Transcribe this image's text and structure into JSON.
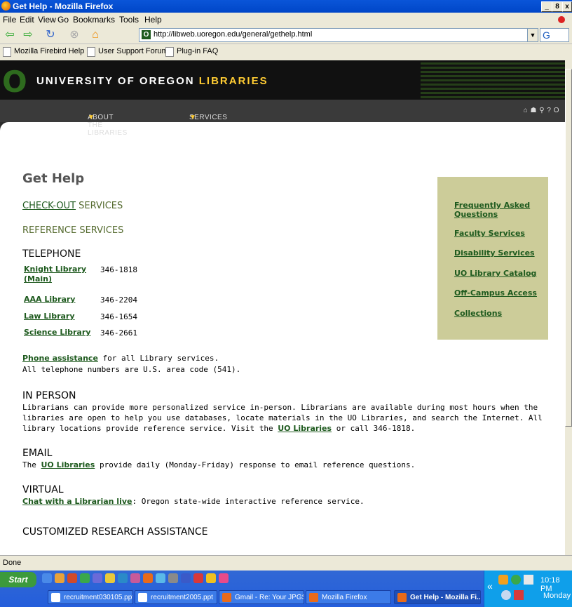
{
  "window": {
    "title": "Get Help - Mozilla Firefox",
    "min": "_",
    "max": "8",
    "close": "x"
  },
  "menu": [
    "File",
    "Edit",
    "View",
    "Go",
    "Bookmarks",
    "Tools",
    "Help"
  ],
  "address": {
    "url": "http://libweb.uoregon.edu/general/gethelp.html"
  },
  "bookmarks": [
    "Mozilla Firebird Help",
    "User Support Forum",
    "Plug-in FAQ"
  ],
  "site": {
    "logo_o": "O",
    "name_part1": "UNIVERSITY OF OREGON ",
    "name_part2": "LIBRARIES",
    "nav": [
      "ABOUT THE LIBRARIES",
      "SERVICES"
    ],
    "nav_arrow": "▼",
    "nav_icons": "⌂ ☗ ⚲ ? O"
  },
  "page": {
    "title": "Get Help",
    "checkout_link": "CHECK-OUT",
    "checkout_rest": " SERVICES",
    "reference": "REFERENCE SERVICES",
    "telephone": "TELEPHONE",
    "phones": [
      {
        "name": "Knight Library (Main)",
        "number": "346-1818"
      },
      {
        "name": "AAA Library",
        "number": "346-2204"
      },
      {
        "name": "Law Library",
        "number": "346-1654"
      },
      {
        "name": "Science Library",
        "number": "346-2661"
      }
    ],
    "phone_assist_link": "Phone assistance",
    "phone_assist_rest": " for all Library services.",
    "area_code": "All telephone numbers are U.S. area code (541).",
    "in_person_h": "IN PERSON",
    "in_person_text": "Librarians can provide more personalized service in-person. Librarians are available during most hours when the libraries are open to help you use databases, locate materials in the UO Libraries, and search the Internet. All library locations provide reference service. Visit the ",
    "in_person_link": "UO Libraries",
    "in_person_end": " or call 346-1818.",
    "email_h": "EMAIL",
    "email_pre": "The ",
    "email_link": "UO Libraries",
    "email_rest": " provide daily (Monday-Friday) response to email reference questions.",
    "virtual_h": "VIRTUAL",
    "virtual_link": "Chat with a Librarian live",
    "virtual_rest": ": Oregon state-wide interactive reference service.",
    "custom_h": "CUSTOMIZED RESEARCH ASSISTANCE"
  },
  "sidebar": [
    "Frequently Asked Questions",
    "Faculty Services",
    "Disability Services",
    "UO Library Catalog",
    "Off-Campus Access",
    "Collections"
  ],
  "status": "Done",
  "taskbar": {
    "start": "Start",
    "tasks": [
      "recruitment030105.ppt",
      "recruitment2005.ppt",
      "Gmail - Re: Your JPGS - ...",
      "Mozilla Firefox",
      "Get Help - Mozilla Fi..."
    ],
    "time": "10:18 PM",
    "day": "Monday"
  },
  "colors": {
    "accent": "#1E5A1E",
    "sidebar_bg": "#CCCC99",
    "page_bg": "#FFFF66"
  }
}
